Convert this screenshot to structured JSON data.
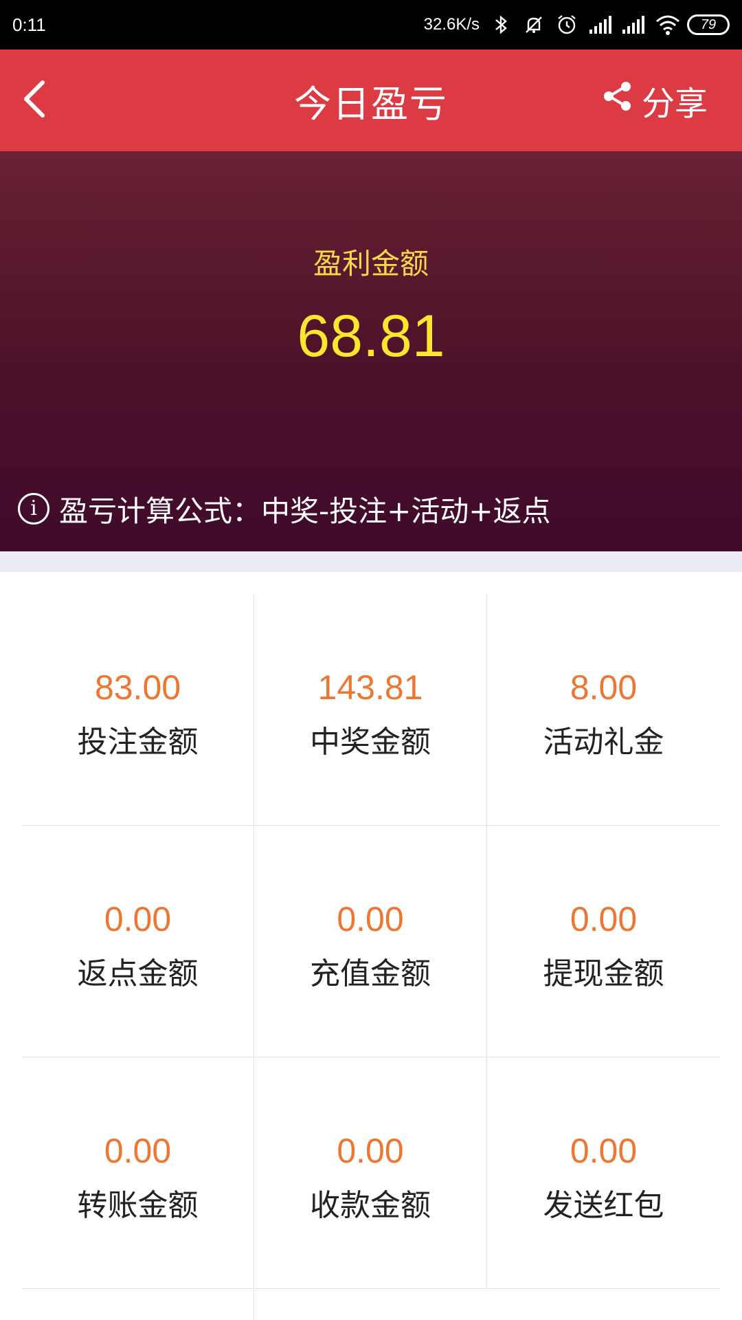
{
  "status_bar": {
    "time": "0:11",
    "net_speed": "32.6K/s",
    "battery": "79",
    "icons": [
      "bluetooth-icon",
      "mute-icon",
      "alarm-icon",
      "signal-icon",
      "signal-icon",
      "wifi-icon",
      "battery-icon"
    ]
  },
  "header": {
    "title": "今日盈亏",
    "share_label": "分享",
    "back_icon": "chevron-left-icon",
    "share_icon": "share-icon"
  },
  "hero": {
    "label": "盈利金额",
    "amount": "68.81",
    "formula": "盈亏计算公式：中奖-投注+活动+返点",
    "info_icon": "info-icon"
  },
  "stats": [
    {
      "value": "83.00",
      "label": "投注金额"
    },
    {
      "value": "143.81",
      "label": "中奖金额"
    },
    {
      "value": "8.00",
      "label": "活动礼金"
    },
    {
      "value": "0.00",
      "label": "返点金额"
    },
    {
      "value": "0.00",
      "label": "充值金额"
    },
    {
      "value": "0.00",
      "label": "提现金额"
    },
    {
      "value": "0.00",
      "label": "转账金额"
    },
    {
      "value": "0.00",
      "label": "收款金额"
    },
    {
      "value": "0.00",
      "label": "发送红包"
    }
  ],
  "colors": {
    "header_bg": "#dd3b44",
    "hero_top": "#682233",
    "hero_bottom": "#3f0a2b",
    "hero_label": "#f7d84a",
    "hero_amount": "#ffe62e",
    "stat_value": "#ee7633",
    "stat_label": "#222222"
  }
}
